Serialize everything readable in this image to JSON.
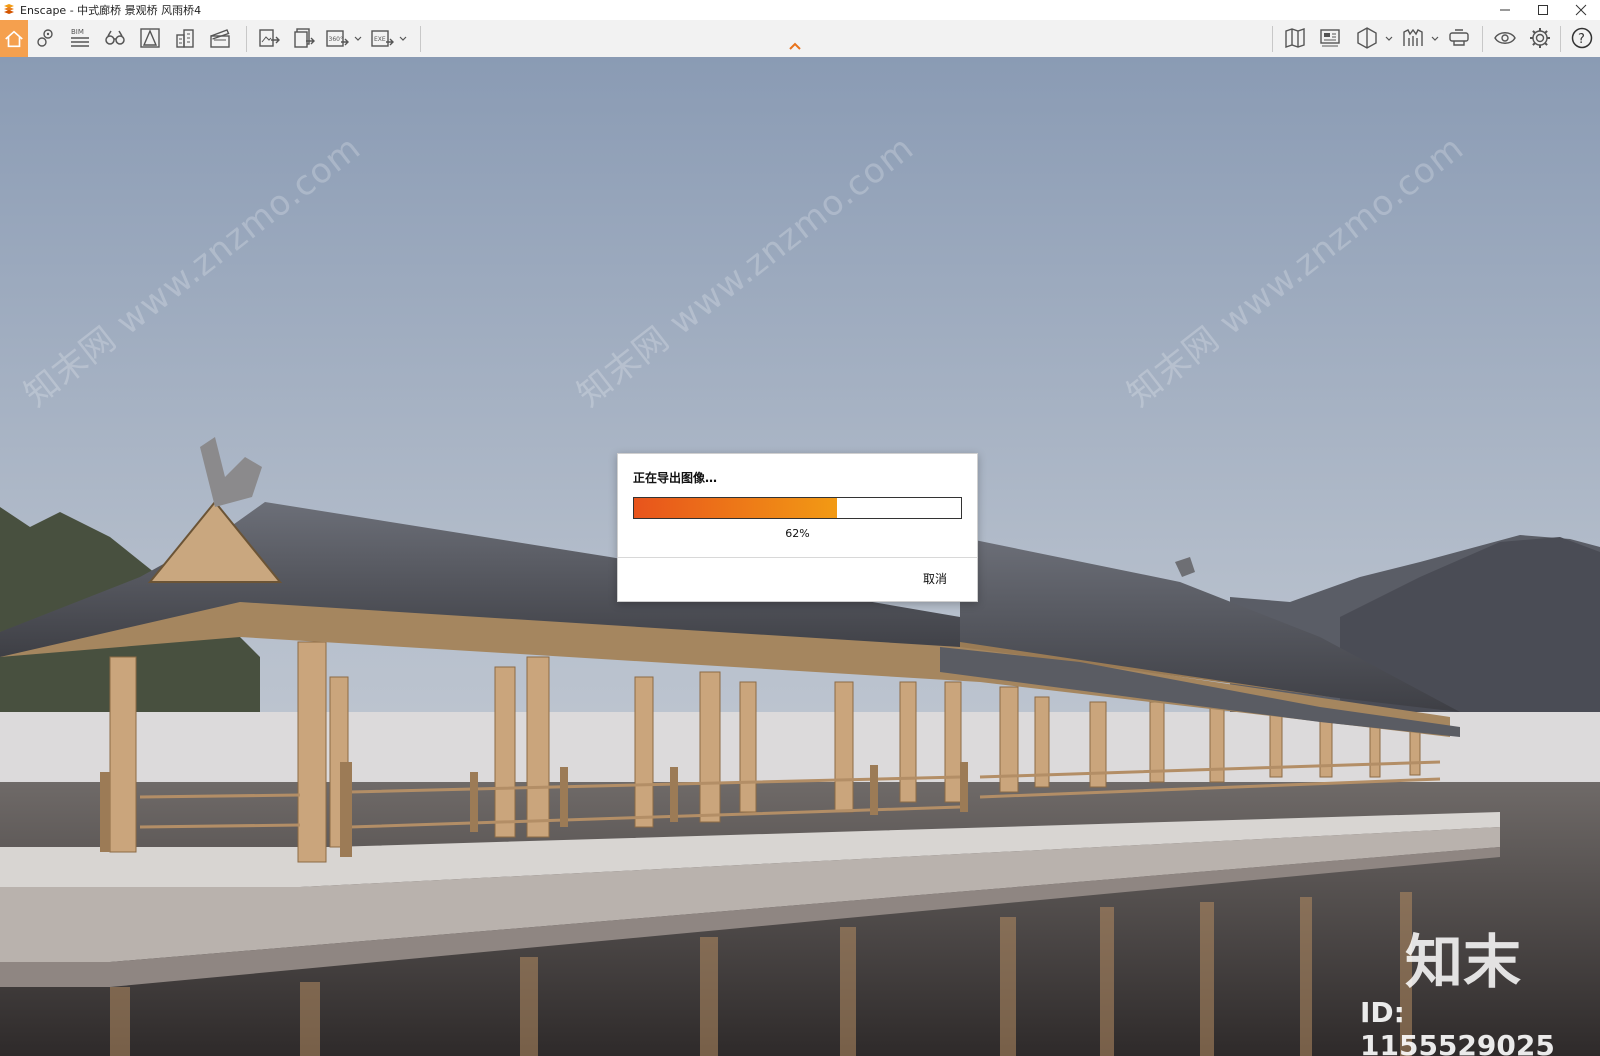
{
  "window": {
    "title": "Enscape - 中式廊桥 景观桥 风雨桥4"
  },
  "toolbar": {
    "left_tools": [
      {
        "icon": "home-icon",
        "active": true
      },
      {
        "icon": "location-pin-icon"
      },
      {
        "icon": "bim-icon",
        "label": "BIM"
      },
      {
        "icon": "binoculars-icon"
      },
      {
        "icon": "perspective-icon"
      },
      {
        "icon": "buildings-icon"
      },
      {
        "icon": "clapperboard-icon"
      },
      {
        "icon": "export-image-icon"
      },
      {
        "icon": "batch-export-icon"
      },
      {
        "icon": "panorama-360-icon",
        "label": "360°"
      },
      {
        "icon": "export-exe-icon",
        "label": "EXE"
      }
    ],
    "right_tools": [
      {
        "icon": "map-icon"
      },
      {
        "icon": "billboard-icon"
      },
      {
        "icon": "cube-icon"
      },
      {
        "icon": "material-library-icon"
      },
      {
        "icon": "vr-headset-icon"
      },
      {
        "icon": "visibility-eye-icon"
      },
      {
        "icon": "settings-gear-icon"
      },
      {
        "icon": "help-icon",
        "label": "?"
      }
    ]
  },
  "dialog": {
    "title": "正在导出图像…",
    "progress": 0.62,
    "percent_label": "62%",
    "cancel_label": "取消"
  },
  "watermark": {
    "site": "知末网 www.znzmo.com",
    "logo": "知末",
    "id": "ID: 1155529025"
  },
  "colors": {
    "accent": "#f5a04e",
    "progress_start": "#e8541c",
    "progress_end": "#f29a14"
  }
}
